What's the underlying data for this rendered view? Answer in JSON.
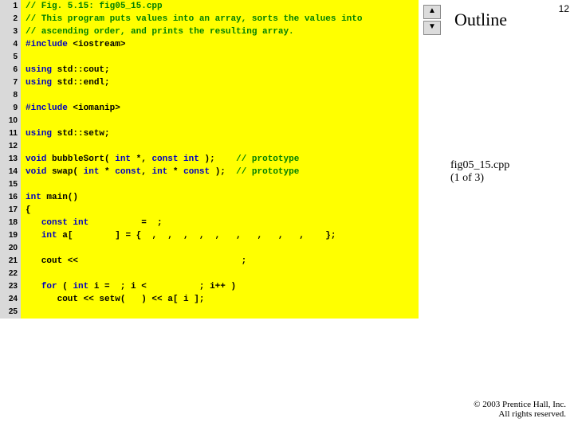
{
  "page_number": "12",
  "outline_heading": "Outline",
  "fig_label_line1": "fig05_15.cpp",
  "fig_label_line2": "(1 of 3)",
  "copyright_line1": "© 2003 Prentice Hall, Inc.",
  "copyright_line2": "All rights reserved.",
  "scroll_up_glyph": "▲",
  "scroll_down_glyph": "▼",
  "code_lines": [
    {
      "n": "1",
      "segs": [
        {
          "cls": "c-comment",
          "t": "// Fig. 5.15: fig05_15.cpp"
        }
      ]
    },
    {
      "n": "2",
      "segs": [
        {
          "cls": "c-comment",
          "t": "// This program puts values into an array, sorts the values into"
        }
      ]
    },
    {
      "n": "3",
      "segs": [
        {
          "cls": "c-comment",
          "t": "// ascending order, and prints the resulting array."
        }
      ]
    },
    {
      "n": "4",
      "segs": [
        {
          "cls": "c-pre",
          "t": "#include "
        },
        {
          "cls": "c-id",
          "t": "<iostream>"
        }
      ]
    },
    {
      "n": "5",
      "segs": [
        {
          "cls": "c-id",
          "t": ""
        }
      ]
    },
    {
      "n": "6",
      "segs": [
        {
          "cls": "c-kw",
          "t": "using "
        },
        {
          "cls": "c-id",
          "t": "std::cout;"
        }
      ]
    },
    {
      "n": "7",
      "segs": [
        {
          "cls": "c-kw",
          "t": "using "
        },
        {
          "cls": "c-id",
          "t": "std::endl;"
        }
      ]
    },
    {
      "n": "8",
      "segs": [
        {
          "cls": "c-id",
          "t": ""
        }
      ]
    },
    {
      "n": "9",
      "segs": [
        {
          "cls": "c-pre",
          "t": "#include "
        },
        {
          "cls": "c-id",
          "t": "<iomanip>"
        }
      ]
    },
    {
      "n": "10",
      "segs": [
        {
          "cls": "c-id",
          "t": ""
        }
      ]
    },
    {
      "n": "11",
      "segs": [
        {
          "cls": "c-kw",
          "t": "using "
        },
        {
          "cls": "c-id",
          "t": "std::setw;"
        }
      ]
    },
    {
      "n": "12",
      "segs": [
        {
          "cls": "c-id",
          "t": ""
        }
      ]
    },
    {
      "n": "13",
      "segs": [
        {
          "cls": "c-kw",
          "t": "void "
        },
        {
          "cls": "c-id",
          "t": "bubbleSort( "
        },
        {
          "cls": "c-kw",
          "t": "int"
        },
        {
          "cls": "c-id",
          "t": " *, "
        },
        {
          "cls": "c-kw",
          "t": "const int"
        },
        {
          "cls": "c-id",
          "t": " );    "
        },
        {
          "cls": "c-comment",
          "t": "// prototype"
        }
      ]
    },
    {
      "n": "14",
      "segs": [
        {
          "cls": "c-kw",
          "t": "void "
        },
        {
          "cls": "c-id",
          "t": "swap( "
        },
        {
          "cls": "c-kw",
          "t": "int"
        },
        {
          "cls": "c-id",
          "t": " * "
        },
        {
          "cls": "c-kw",
          "t": "const"
        },
        {
          "cls": "c-id",
          "t": ", "
        },
        {
          "cls": "c-kw",
          "t": "int"
        },
        {
          "cls": "c-id",
          "t": " * "
        },
        {
          "cls": "c-kw",
          "t": "const"
        },
        {
          "cls": "c-id",
          "t": " );  "
        },
        {
          "cls": "c-comment",
          "t": "// prototype"
        }
      ]
    },
    {
      "n": "15",
      "segs": [
        {
          "cls": "c-id",
          "t": ""
        }
      ]
    },
    {
      "n": "16",
      "segs": [
        {
          "cls": "c-kw",
          "t": "int "
        },
        {
          "cls": "c-id",
          "t": "main()"
        }
      ]
    },
    {
      "n": "17",
      "segs": [
        {
          "cls": "c-id",
          "t": "{"
        }
      ]
    },
    {
      "n": "18",
      "segs": [
        {
          "cls": "c-id",
          "t": "   "
        },
        {
          "cls": "c-kw",
          "t": "const int"
        },
        {
          "cls": "c-id",
          "t": "          =  ;"
        }
      ]
    },
    {
      "n": "19",
      "segs": [
        {
          "cls": "c-id",
          "t": "   "
        },
        {
          "cls": "c-kw",
          "t": "int"
        },
        {
          "cls": "c-id",
          "t": " a[        ] = {  ,  ,  ,  ,  ,   ,   ,   ,   ,    };"
        }
      ]
    },
    {
      "n": "20",
      "segs": [
        {
          "cls": "c-id",
          "t": ""
        }
      ]
    },
    {
      "n": "21",
      "segs": [
        {
          "cls": "c-id",
          "t": "   cout <<                               ;"
        }
      ]
    },
    {
      "n": "22",
      "segs": [
        {
          "cls": "c-id",
          "t": ""
        }
      ]
    },
    {
      "n": "23",
      "segs": [
        {
          "cls": "c-id",
          "t": "   "
        },
        {
          "cls": "c-kw",
          "t": "for"
        },
        {
          "cls": "c-id",
          "t": " ( "
        },
        {
          "cls": "c-kw",
          "t": "int"
        },
        {
          "cls": "c-id",
          "t": " i =  ; i <          ; i++ )"
        }
      ]
    },
    {
      "n": "24",
      "segs": [
        {
          "cls": "c-id",
          "t": "      cout << setw(   ) << a[ i ];"
        }
      ]
    },
    {
      "n": "25",
      "segs": [
        {
          "cls": "c-id",
          "t": ""
        }
      ]
    }
  ]
}
